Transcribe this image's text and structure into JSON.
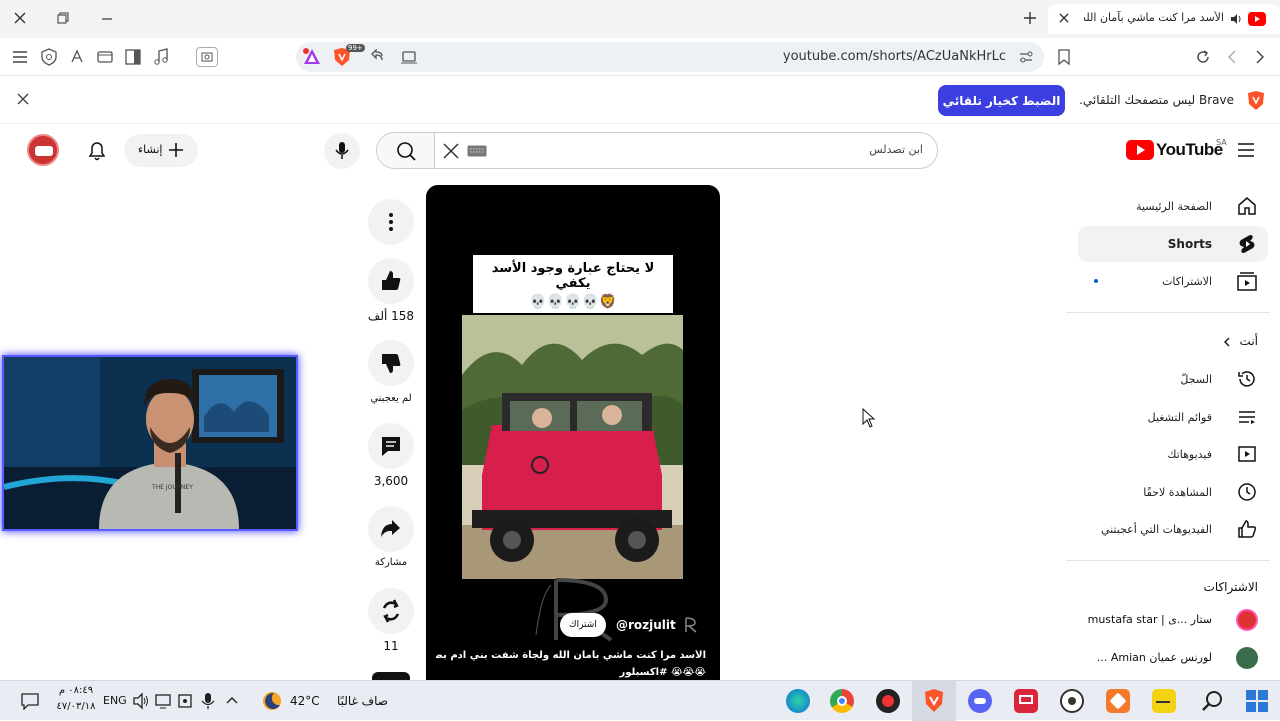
{
  "browser": {
    "tab_title": "الأسد مرا كنت ماشي بآمان الله و",
    "url": "youtube.com/shorts/ACzUaNkHrLc",
    "shields_count": "99+",
    "infobar_text": "Brave ليس متصفحك التلقائي.",
    "infobar_button": "الضبط كخيار تلقائي"
  },
  "header": {
    "logo_text": "YouTube",
    "region": "SA",
    "search_placeholder": "ابن تصدلس",
    "create_label": "إنشاء"
  },
  "sidebar": {
    "items": [
      {
        "label": "الصفحة الرئيسية",
        "icon": "home-icon"
      },
      {
        "label": "Shorts",
        "icon": "shorts-icon"
      },
      {
        "label": "الاشتراكات",
        "icon": "subscriptions-icon"
      }
    ],
    "you_label": "أنت",
    "you_items": [
      {
        "label": "السجلّ",
        "icon": "history-icon"
      },
      {
        "label": "قوائم التشغيل",
        "icon": "playlist-icon"
      },
      {
        "label": "فيديوهاتك",
        "icon": "your-videos-icon"
      },
      {
        "label": "المشاهدة لاحقًا",
        "icon": "watch-later-icon"
      },
      {
        "label": "الفيديوهات التي أعجبتني",
        "icon": "liked-icon"
      }
    ],
    "subs_heading": "الاشتراكات",
    "subs": [
      {
        "label": "mustafa star | ستار ...ى"
      },
      {
        "label": "لورنس عميان Amian ..."
      }
    ]
  },
  "short": {
    "overlay_title": "لا يحتاج عبارة وجود الأسد يكفي",
    "overlay_emojis": "💀💀💀💀🦁",
    "channel": "@rozjulit",
    "subscribe": "اشتراك",
    "caption_line1": "الأسد مرا كنت ماشي بآمان الله ولجأة شفت بني ادم بصور بخاتي",
    "caption_line2": "😭😭😭 #اكسبلور"
  },
  "actions": {
    "likes": "158 ألف",
    "dislike": "لم يعجبني",
    "comments": "3,600",
    "share": "مشاركة",
    "remix": "11"
  },
  "taskbar": {
    "time": "٠٨:٤٩ م",
    "date": "٤٧/٠٣/١٨",
    "lang": "ENG",
    "temp": "42°C",
    "weather": "صاف غالبًا"
  },
  "colors": {
    "yt_red": "#ff0000",
    "brave_orange": "#fb542b",
    "accent_blue": "#3b3fe0"
  }
}
